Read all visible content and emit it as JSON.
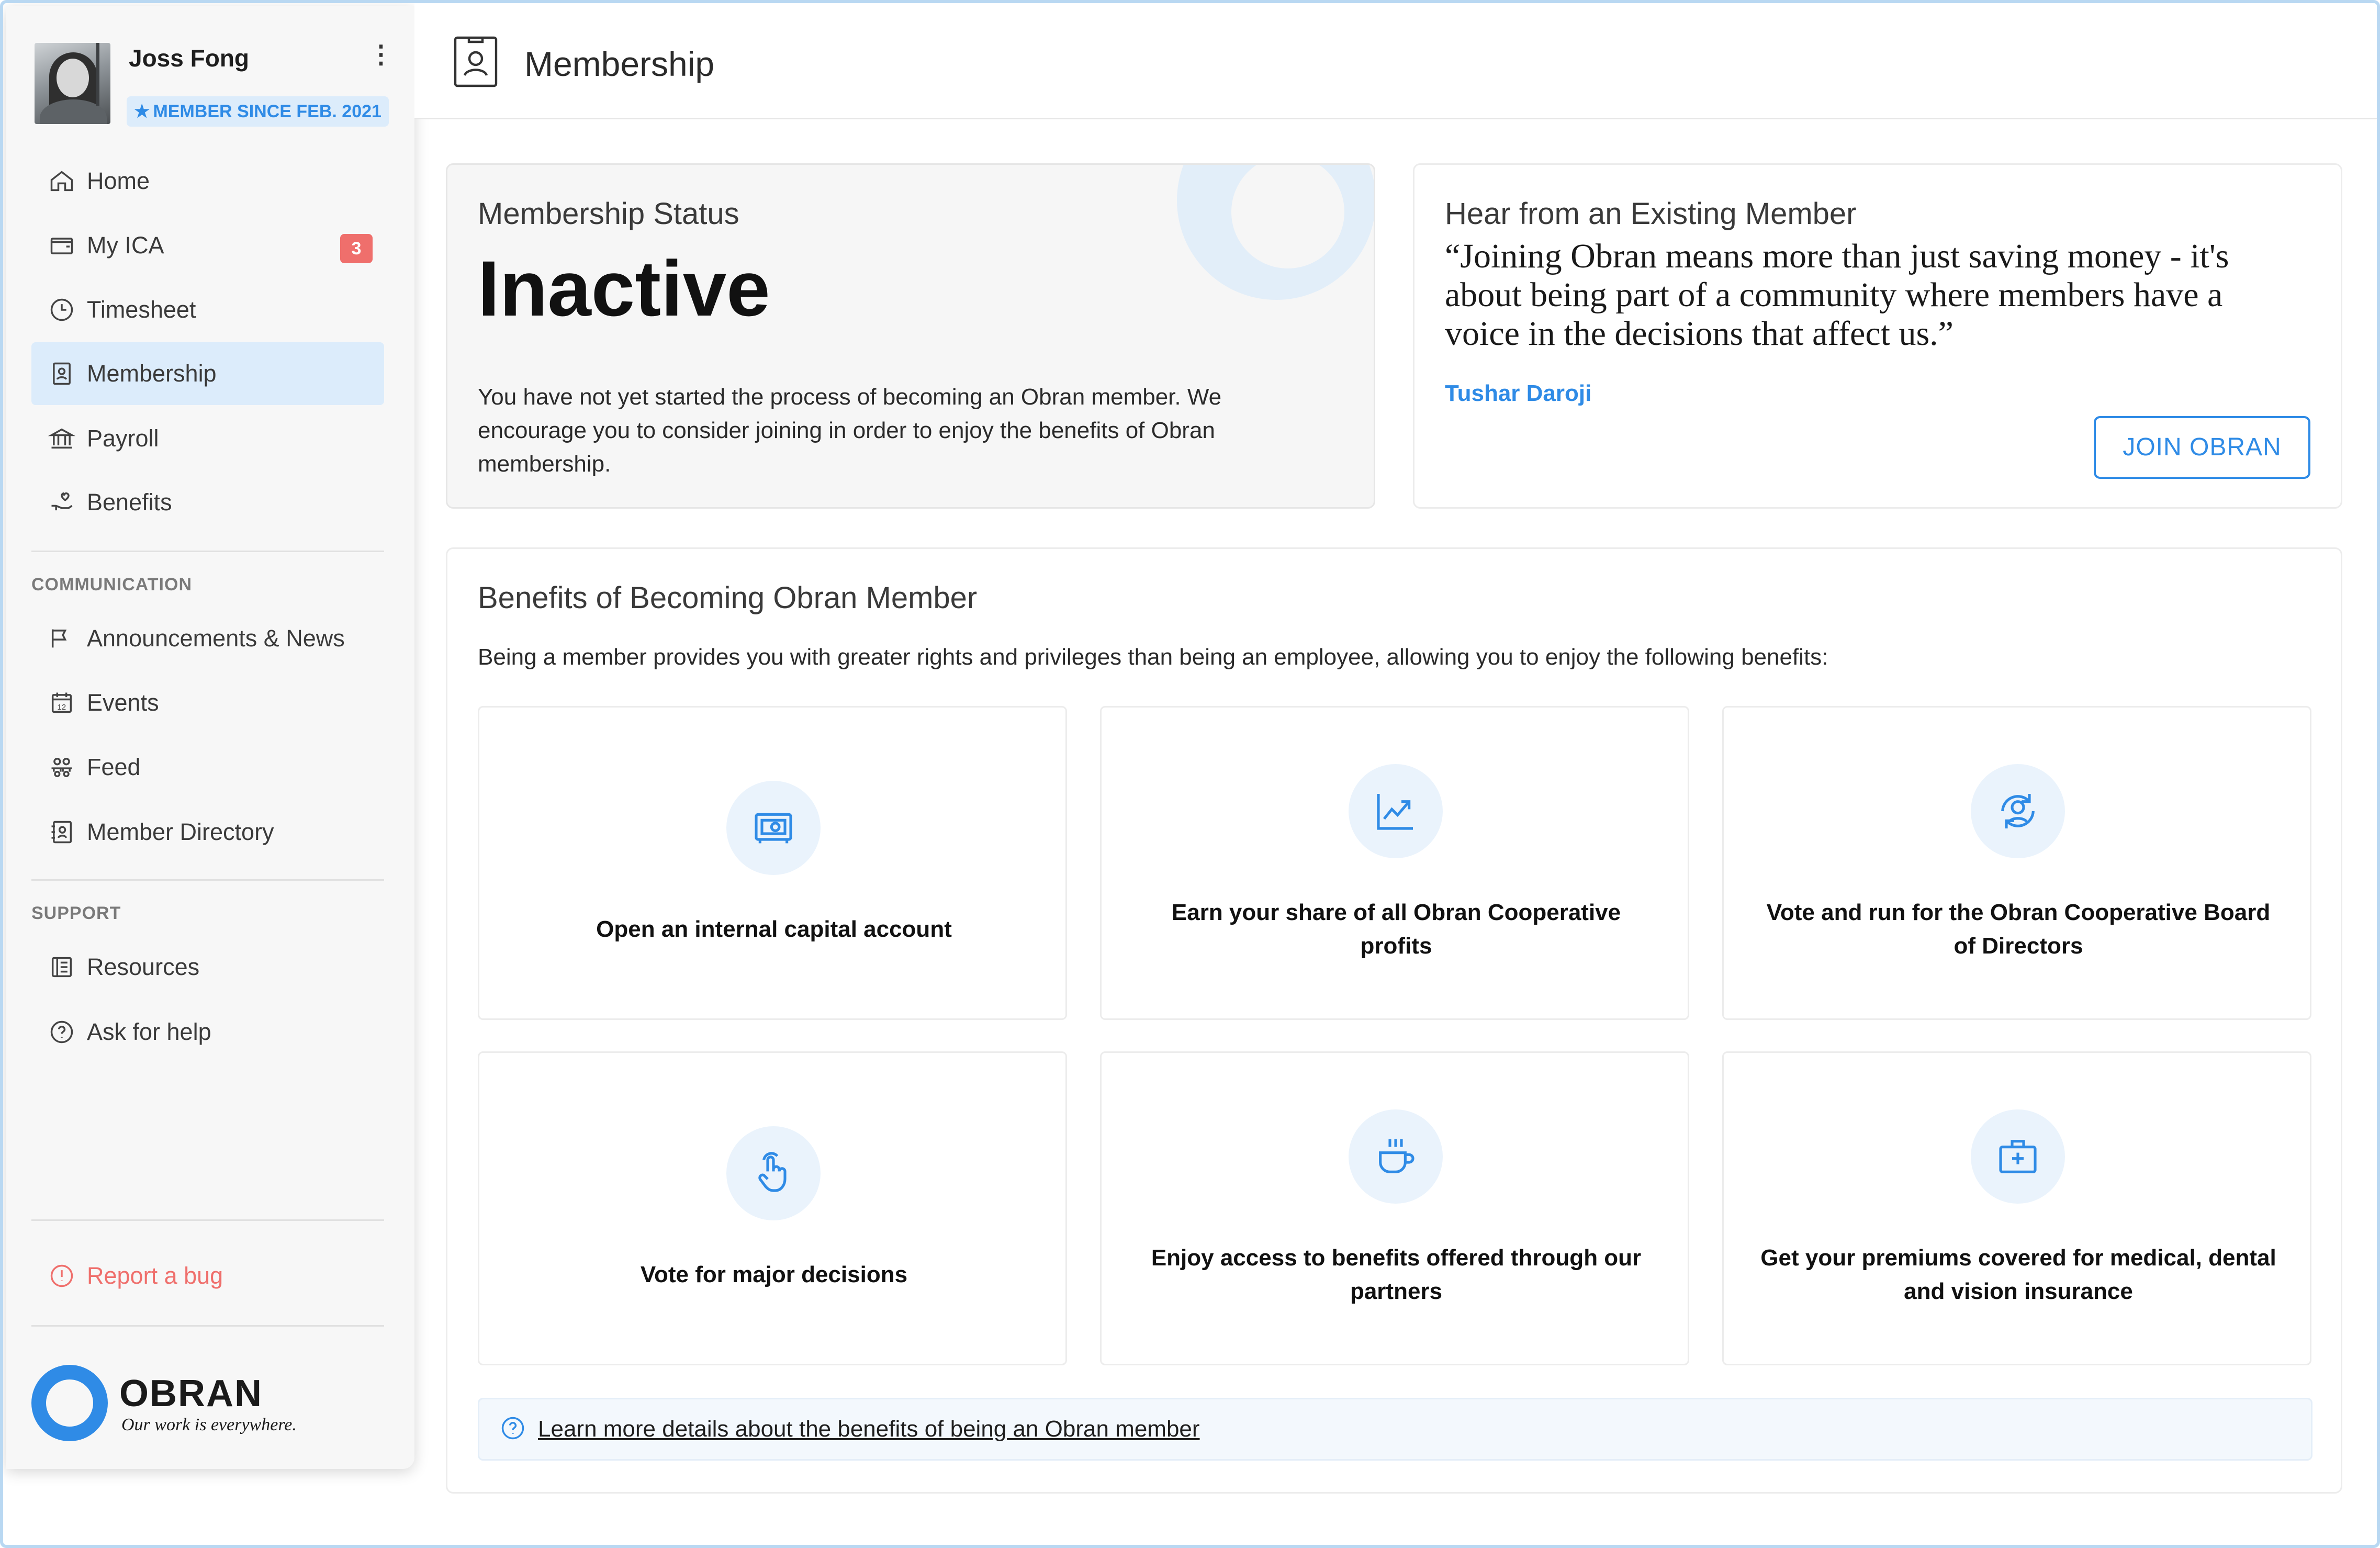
{
  "colors": {
    "accent": "#2f8be6",
    "badge_red": "#ef6f6c",
    "active_bg": "#dcecfb"
  },
  "user": {
    "name": "Joss Fong",
    "member_since": "MEMBER SINCE FEB. 2021"
  },
  "sidebar": {
    "main_items": [
      {
        "label": "Home",
        "icon": "home-icon"
      },
      {
        "label": "My ICA",
        "icon": "wallet-icon",
        "badge": "3"
      },
      {
        "label": "Timesheet",
        "icon": "clock-icon"
      },
      {
        "label": "Membership",
        "icon": "id-badge-icon",
        "active": true
      },
      {
        "label": "Payroll",
        "icon": "bank-icon"
      },
      {
        "label": "Benefits",
        "icon": "hand-heart-icon"
      }
    ],
    "communication_heading": "COMMUNICATION",
    "communication_items": [
      {
        "label": "Announcements & News",
        "icon": "megaphone-icon"
      },
      {
        "label": "Events",
        "icon": "calendar-icon"
      },
      {
        "label": "Feed",
        "icon": "people-icon"
      },
      {
        "label": "Member Directory",
        "icon": "contacts-book-icon"
      }
    ],
    "support_heading": "SUPPORT",
    "support_items": [
      {
        "label": "Resources",
        "icon": "document-list-icon"
      },
      {
        "label": "Ask for help",
        "icon": "help-circle-icon"
      }
    ],
    "report_bug": "Report a bug"
  },
  "brand": {
    "name": "OBRAN",
    "tagline": "Our work is everywhere."
  },
  "header": {
    "title": "Membership"
  },
  "status_card": {
    "label": "Membership Status",
    "value": "Inactive",
    "text": "You have not yet started the process of becoming an Obran member. We encourage you to consider joining in order to enjoy the benefits of Obran membership."
  },
  "quote_card": {
    "label": "Hear from an Existing Member",
    "quote": "“Joining Obran means more than just saving money - it's about being part of a community where members have a voice in the decisions that affect us.”",
    "author": "Tushar Daroji",
    "button": "JOIN OBRAN"
  },
  "benefits": {
    "title": "Benefits of Becoming Obran Member",
    "subtitle": "Being a member provides you with greater rights and privileges than being an employee, allowing you to enjoy the following benefits:",
    "tiles": [
      {
        "label": "Open an internal capital account",
        "icon": "safe-icon"
      },
      {
        "label": "Earn your share of all Obran Cooperative profits",
        "icon": "chart-up-icon"
      },
      {
        "label": "Vote and run for the Obran Cooperative Board of Directors",
        "icon": "user-cycle-icon"
      },
      {
        "label": "Vote for major decisions",
        "icon": "hand-pointer-icon"
      },
      {
        "label": "Enjoy access to benefits offered through our partners",
        "icon": "coffee-cup-icon"
      },
      {
        "label": "Get your premiums covered for medical, dental and vision insurance",
        "icon": "medical-kit-icon"
      }
    ],
    "learn_more": "Learn more details about the benefits of being an Obran member"
  }
}
